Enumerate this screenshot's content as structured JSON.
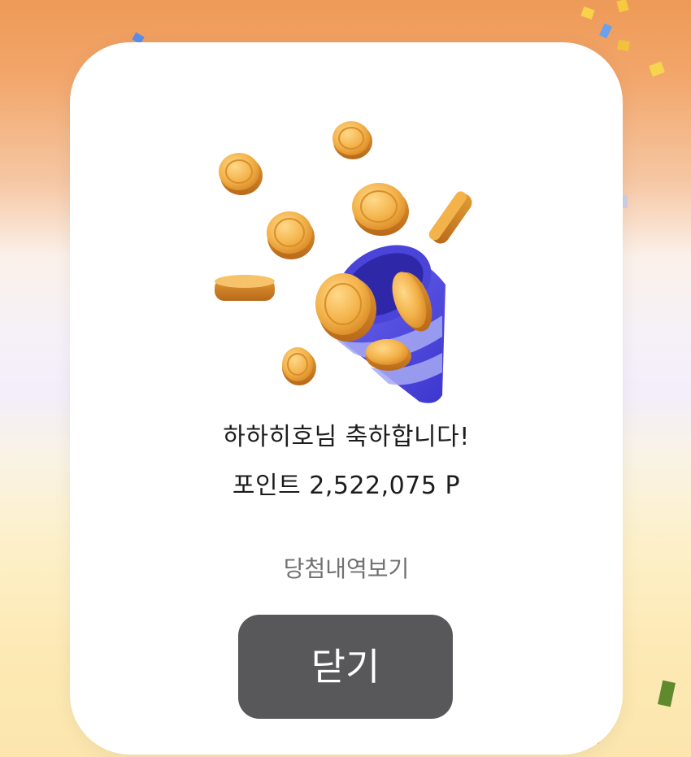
{
  "modal": {
    "message_line1": "하하히호님 축하합니다!",
    "message_line2": "포인트 2,522,075 P",
    "history_link_label": "당첨내역보기",
    "close_button_label": "닫기"
  },
  "colors": {
    "button_background": "#58575a",
    "link_text": "#707070",
    "coin_gold": "#f0b046",
    "party_popper_blue": "#5a55e6"
  },
  "icons": {
    "illustration": "party-popper-coins-icon"
  }
}
